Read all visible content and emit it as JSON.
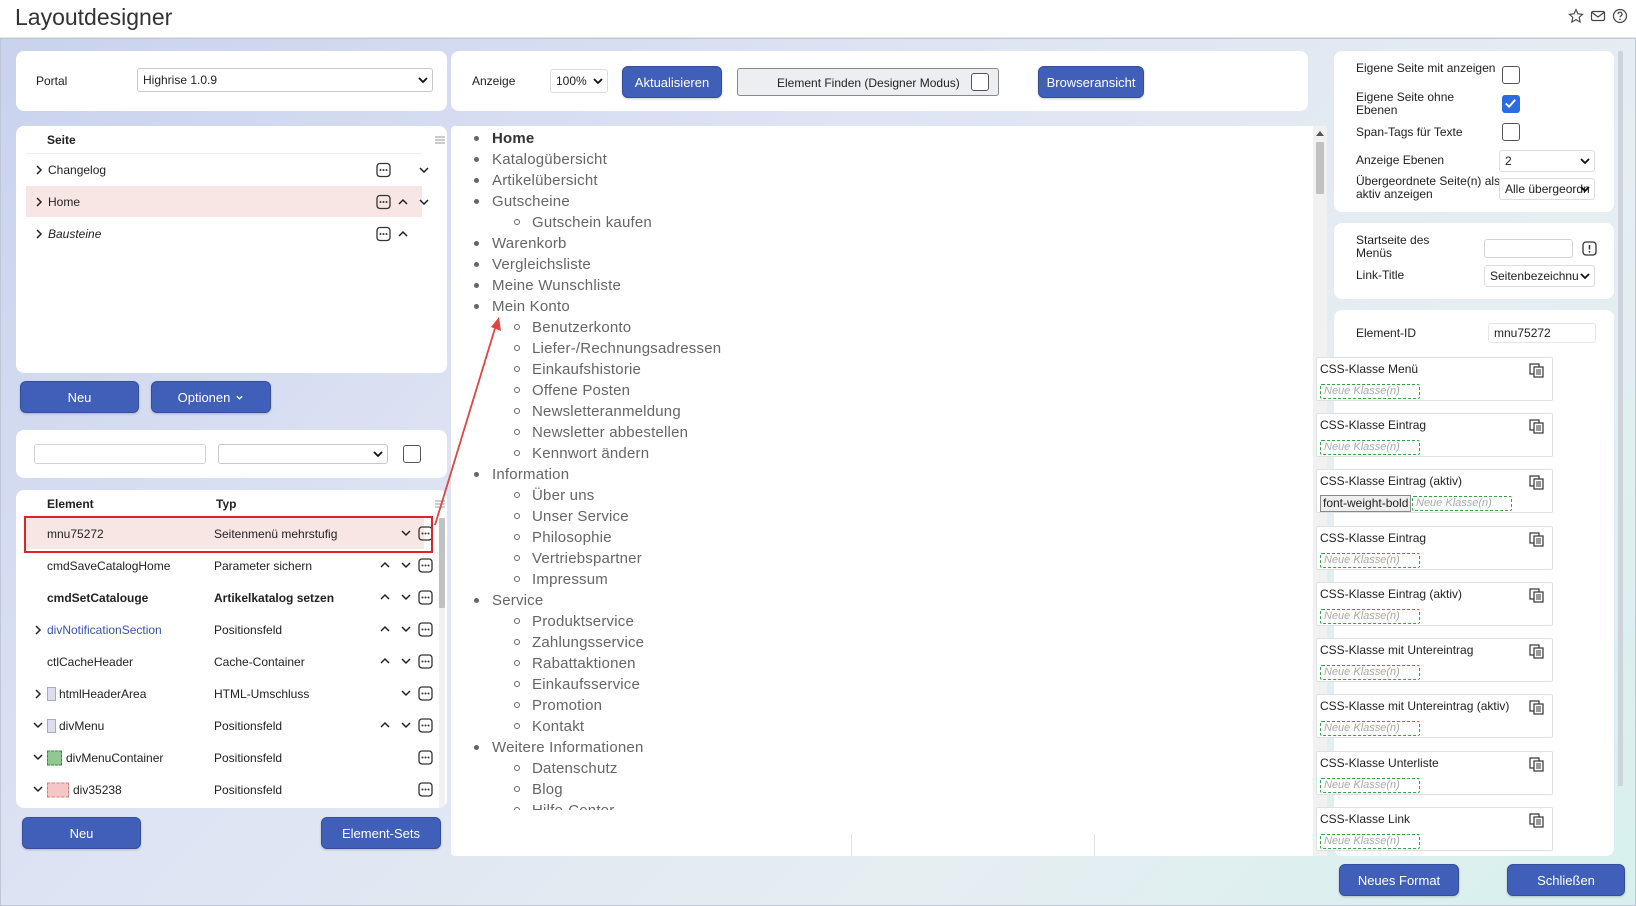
{
  "app": {
    "title": "Layoutdesigner"
  },
  "portal": {
    "label": "Portal",
    "value": "Highrise 1.0.9"
  },
  "pages": {
    "header": "Seite",
    "items": [
      {
        "label": "Changelog"
      },
      {
        "label": "Home"
      },
      {
        "label": "Bausteine"
      }
    ],
    "new_label": "Neu",
    "options_label": "Optionen"
  },
  "elements": {
    "col_element": "Element",
    "col_type": "Typ",
    "rows": [
      {
        "name": "mnu75272",
        "type": "Seitenmenü mehrstufig"
      },
      {
        "name": "cmdSaveCatalogHome",
        "type": "Parameter sichern"
      },
      {
        "name": "cmdSetCatalouge",
        "type": "Artikelkatalog setzen"
      },
      {
        "name": "divNotificationSection",
        "type": "Positionsfeld"
      },
      {
        "name": "ctlCacheHeader",
        "type": "Cache-Container"
      },
      {
        "name": "htmlHeaderArea",
        "type": "HTML-Umschluss"
      },
      {
        "name": "divMenu",
        "type": "Positionsfeld"
      },
      {
        "name": "divMenuContainer",
        "type": "Positionsfeld"
      },
      {
        "name": "div35238",
        "type": "Positionsfeld"
      }
    ],
    "new_label": "Neu",
    "sets_label": "Element-Sets"
  },
  "toolbar": {
    "zoom_label": "Anzeige",
    "zoom_value": "100%",
    "refresh_label": "Aktualisieren",
    "find_label": "Element Finden (Designer Modus)",
    "browser_label": "Browseransicht"
  },
  "preview": {
    "items": [
      {
        "label": "Home",
        "children": []
      },
      {
        "label": "Katalogübersicht",
        "children": []
      },
      {
        "label": "Artikelübersicht",
        "children": []
      },
      {
        "label": "Gutscheine",
        "children": [
          "Gutschein kaufen"
        ]
      },
      {
        "label": "Warenkorb",
        "children": []
      },
      {
        "label": "Vergleichsliste",
        "children": []
      },
      {
        "label": "Meine Wunschliste",
        "children": []
      },
      {
        "label": "Mein Konto",
        "children": [
          "Benutzerkonto",
          "Liefer-/Rechnungsadressen",
          "Einkaufshistorie",
          "Offene Posten",
          "Newsletteranmeldung",
          "Newsletter abbestellen",
          "Kennwort ändern"
        ]
      },
      {
        "label": "Information",
        "children": [
          "Über uns",
          "Unser Service",
          "Philosophie",
          "Vertriebspartner",
          "Impressum"
        ]
      },
      {
        "label": "Service",
        "children": [
          "Produktservice",
          "Zahlungsservice",
          "Rabattaktionen",
          "Einkaufsservice",
          "Promotion",
          "Kontakt"
        ]
      },
      {
        "label": "Weitere Informationen",
        "children": [
          "Datenschutz",
          "Blog",
          "Hilfe-Center"
        ]
      }
    ]
  },
  "settings": {
    "own_page_with": "Eigene Seite mit anzeigen",
    "own_page_without": "Eigene Seite ohne Ebenen",
    "span_tags": "Span-Tags für Texte",
    "levels_label": "Anzeige Ebenen",
    "levels_value": "2",
    "parent_label": "Übergeordnete Seite(n) als aktiv anzeigen",
    "parent_value": "Alle übergeordn",
    "start_label": "Startseite des Menüs",
    "link_title_label": "Link-Title",
    "link_title_value": "Seitenbezeichnu",
    "element_id_label": "Element-ID",
    "element_id_value": "mnu75272",
    "css_cards": [
      {
        "title": "CSS-Klasse Menü",
        "chip": ""
      },
      {
        "title": "CSS-Klasse Eintrag",
        "chip": ""
      },
      {
        "title": "CSS-Klasse Eintrag (aktiv)",
        "chip": "font-weight-bold"
      },
      {
        "title": "CSS-Klasse Eintrag",
        "chip": ""
      },
      {
        "title": "CSS-Klasse Eintrag (aktiv)",
        "chip": ""
      },
      {
        "title": "CSS-Klasse mit Untereintrag",
        "chip": ""
      },
      {
        "title": "CSS-Klasse mit Untereintrag (aktiv)",
        "chip": ""
      },
      {
        "title": "CSS-Klasse Unterliste",
        "chip": ""
      },
      {
        "title": "CSS-Klasse Link",
        "chip": ""
      }
    ],
    "new_class_placeholder": "Neue Klasse(n)",
    "new_format_label": "Neues Format",
    "close_label": "Schließen"
  },
  "colors": {
    "accent": "#3f5fb8",
    "selected_row": "#f8e6e4",
    "highlight_border": "#d9262a",
    "checkbox_on": "#2d6be4"
  }
}
